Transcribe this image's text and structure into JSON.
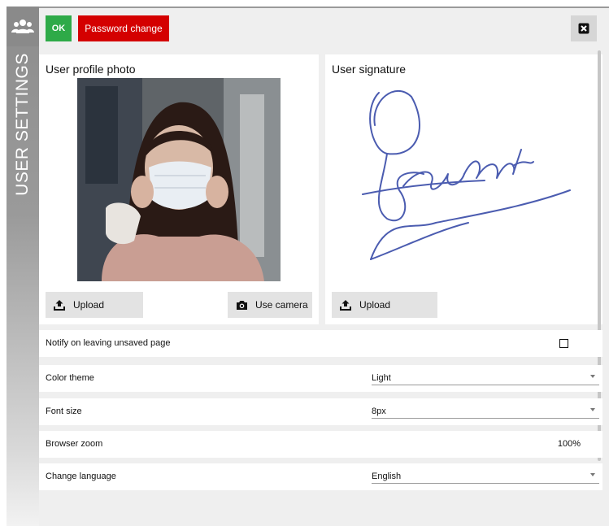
{
  "sidebar": {
    "title": "USER SETTINGS",
    "icon": "users-icon"
  },
  "toolbar": {
    "ok_label": "OK",
    "password_label": "Password change",
    "close_icon": "close-icon",
    "colors": {
      "ok": "#2eaa48",
      "password": "#d40000"
    }
  },
  "photo_card": {
    "title": "User profile photo",
    "upload_label": "Upload",
    "camera_label": "Use camera",
    "upload_icon": "upload-icon",
    "camera_icon": "camera-icon"
  },
  "signature_card": {
    "title": "User signature",
    "upload_label": "Upload",
    "upload_icon": "upload-icon"
  },
  "settings": {
    "notify": {
      "label": "Notify on leaving unsaved page",
      "checked": false
    },
    "color_theme": {
      "label": "Color theme",
      "value": "Light"
    },
    "font_size": {
      "label": "Font size",
      "value": "8px"
    },
    "browser_zoom": {
      "label": "Browser zoom",
      "value": "100%"
    },
    "language": {
      "label": "Change language",
      "value": "English"
    }
  }
}
